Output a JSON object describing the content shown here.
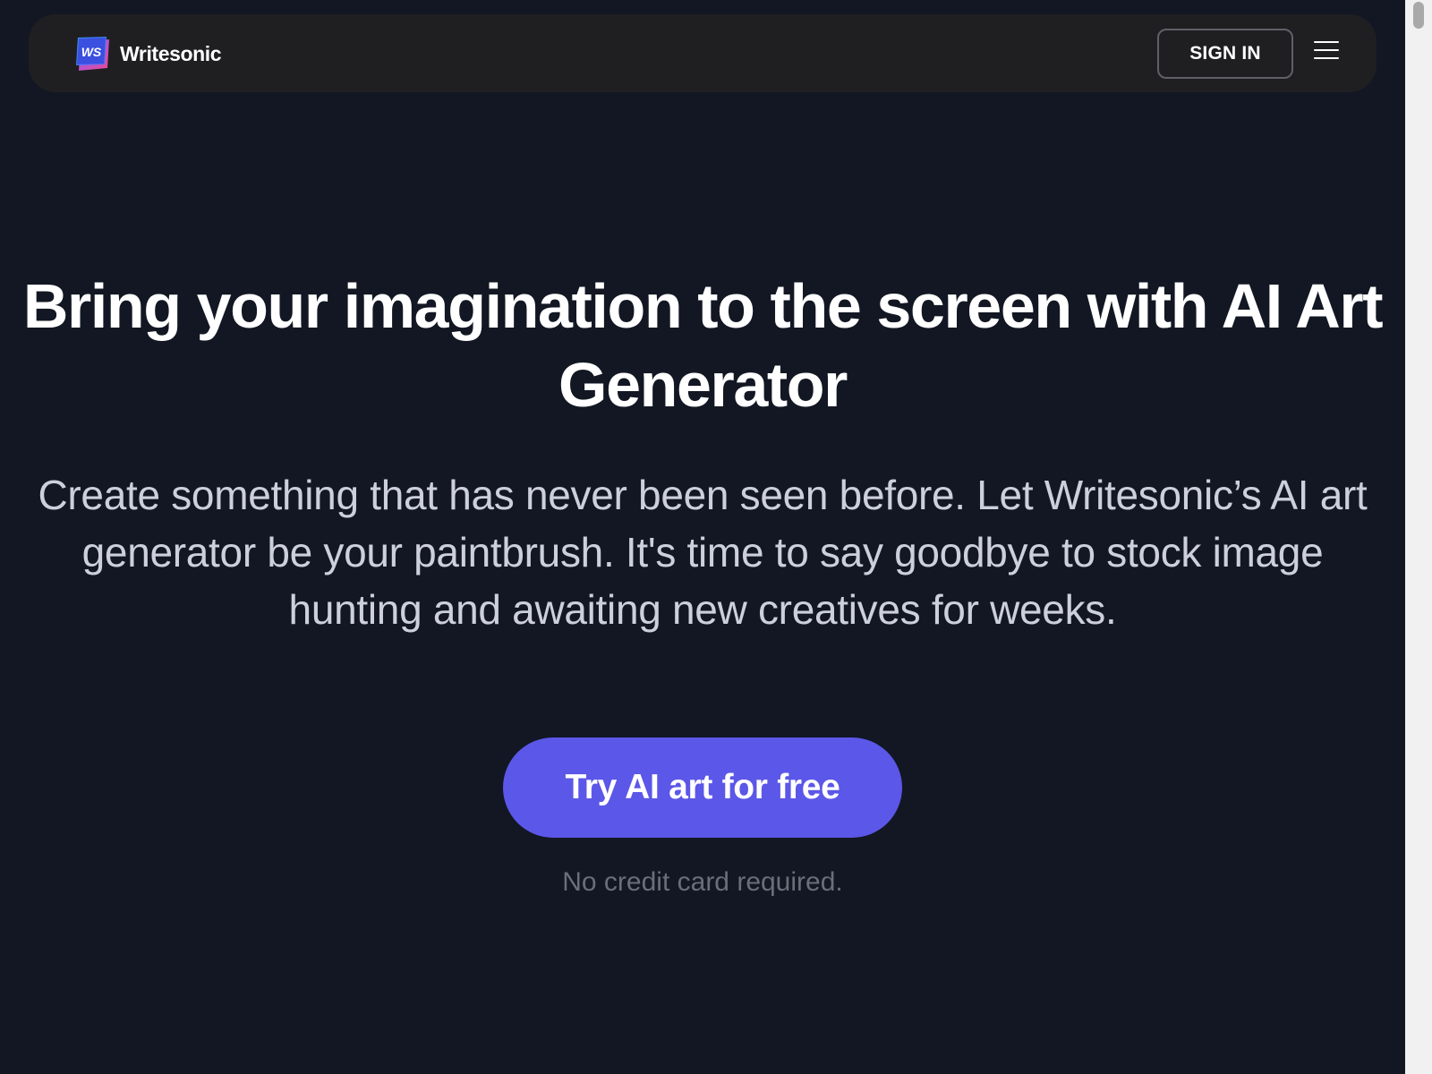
{
  "header": {
    "brand_name": "Writesonic",
    "logo_text": "WS",
    "signin_label": "SIGN IN",
    "menu_icon": "hamburger-menu-icon"
  },
  "hero": {
    "title": "Bring your imagination to the screen with AI Art Generator",
    "subtitle": "Create something that has never been seen before. Let Writesonic’s AI art generator be your paintbrush. It's time to say goodbye to stock image hunting and awaiting new creatives for weeks.",
    "cta_label": "Try AI art for free",
    "note": "No credit card required."
  },
  "colors": {
    "background": "#121723",
    "navbar": "#1f1f22",
    "cta": "#5b57e8",
    "subtitle": "#cdd0dc",
    "note": "#6b6e78"
  }
}
